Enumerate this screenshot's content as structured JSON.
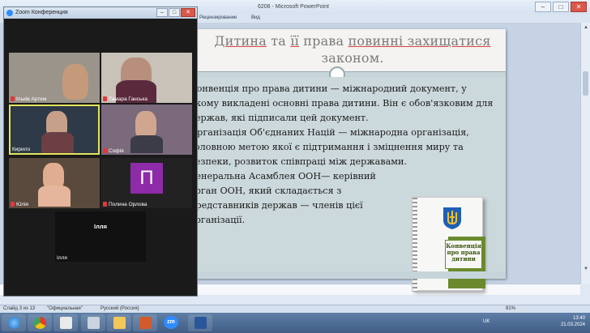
{
  "ppt": {
    "window_title": "6208 - Microsoft PowerPoint",
    "ribbon_tabs": [
      "Рецензирование",
      "Вид"
    ],
    "controls": [
      "–",
      "□",
      "✕"
    ]
  },
  "slide": {
    "title_part1": "Дитина",
    "title_part2": " та ",
    "title_part3": "її",
    "title_part4": " права ",
    "title_part5": "повинні захищатися",
    "title_line2": "законом.",
    "paragraphs": [
      "Конвенція про права дитини — міжнародний документ, у якому викладені основні права дитини. Він є обов'язковим для держав, які підписали цей документ.",
      "Організація Об'єднаних Націй — міжнародна організація, головною метою якої є підтримання і зміцнення миру та безпеки, розвиток співпраці між державами.",
      "Генеральна Асамблея ООН— керівний орган ООН, який складається з представників держав — членів цієї організації."
    ],
    "book_label": "Конвенція про права дитини",
    "book_color": "#6a8a2d"
  },
  "zoom": {
    "title": "Zoom Конференция",
    "controls": [
      "–",
      "□",
      "✕"
    ],
    "participants": [
      {
        "name": "Ільків Артем",
        "muted": true
      },
      {
        "name": "Тамара Ганська",
        "muted": true
      },
      {
        "name": "Кирило",
        "muted": false,
        "active": true
      },
      {
        "name": "Софія",
        "muted": true
      },
      {
        "name": "Юлія",
        "muted": true
      },
      {
        "name": "Полина Орлова",
        "muted": true,
        "avatar_letter": "П"
      },
      {
        "name": "Ілля",
        "muted": false,
        "video_off": true
      }
    ],
    "accent": "#2d8cff"
  },
  "status": {
    "slide": "Слайд 3 из 13",
    "theme": "\"Официальная\"",
    "language": "Русский (Россия)",
    "zoom_level": "81%"
  },
  "taskbar": {
    "lang": "UK",
    "time": "13:40",
    "date": "21.03.2024",
    "zoom_app_label": "zm"
  }
}
